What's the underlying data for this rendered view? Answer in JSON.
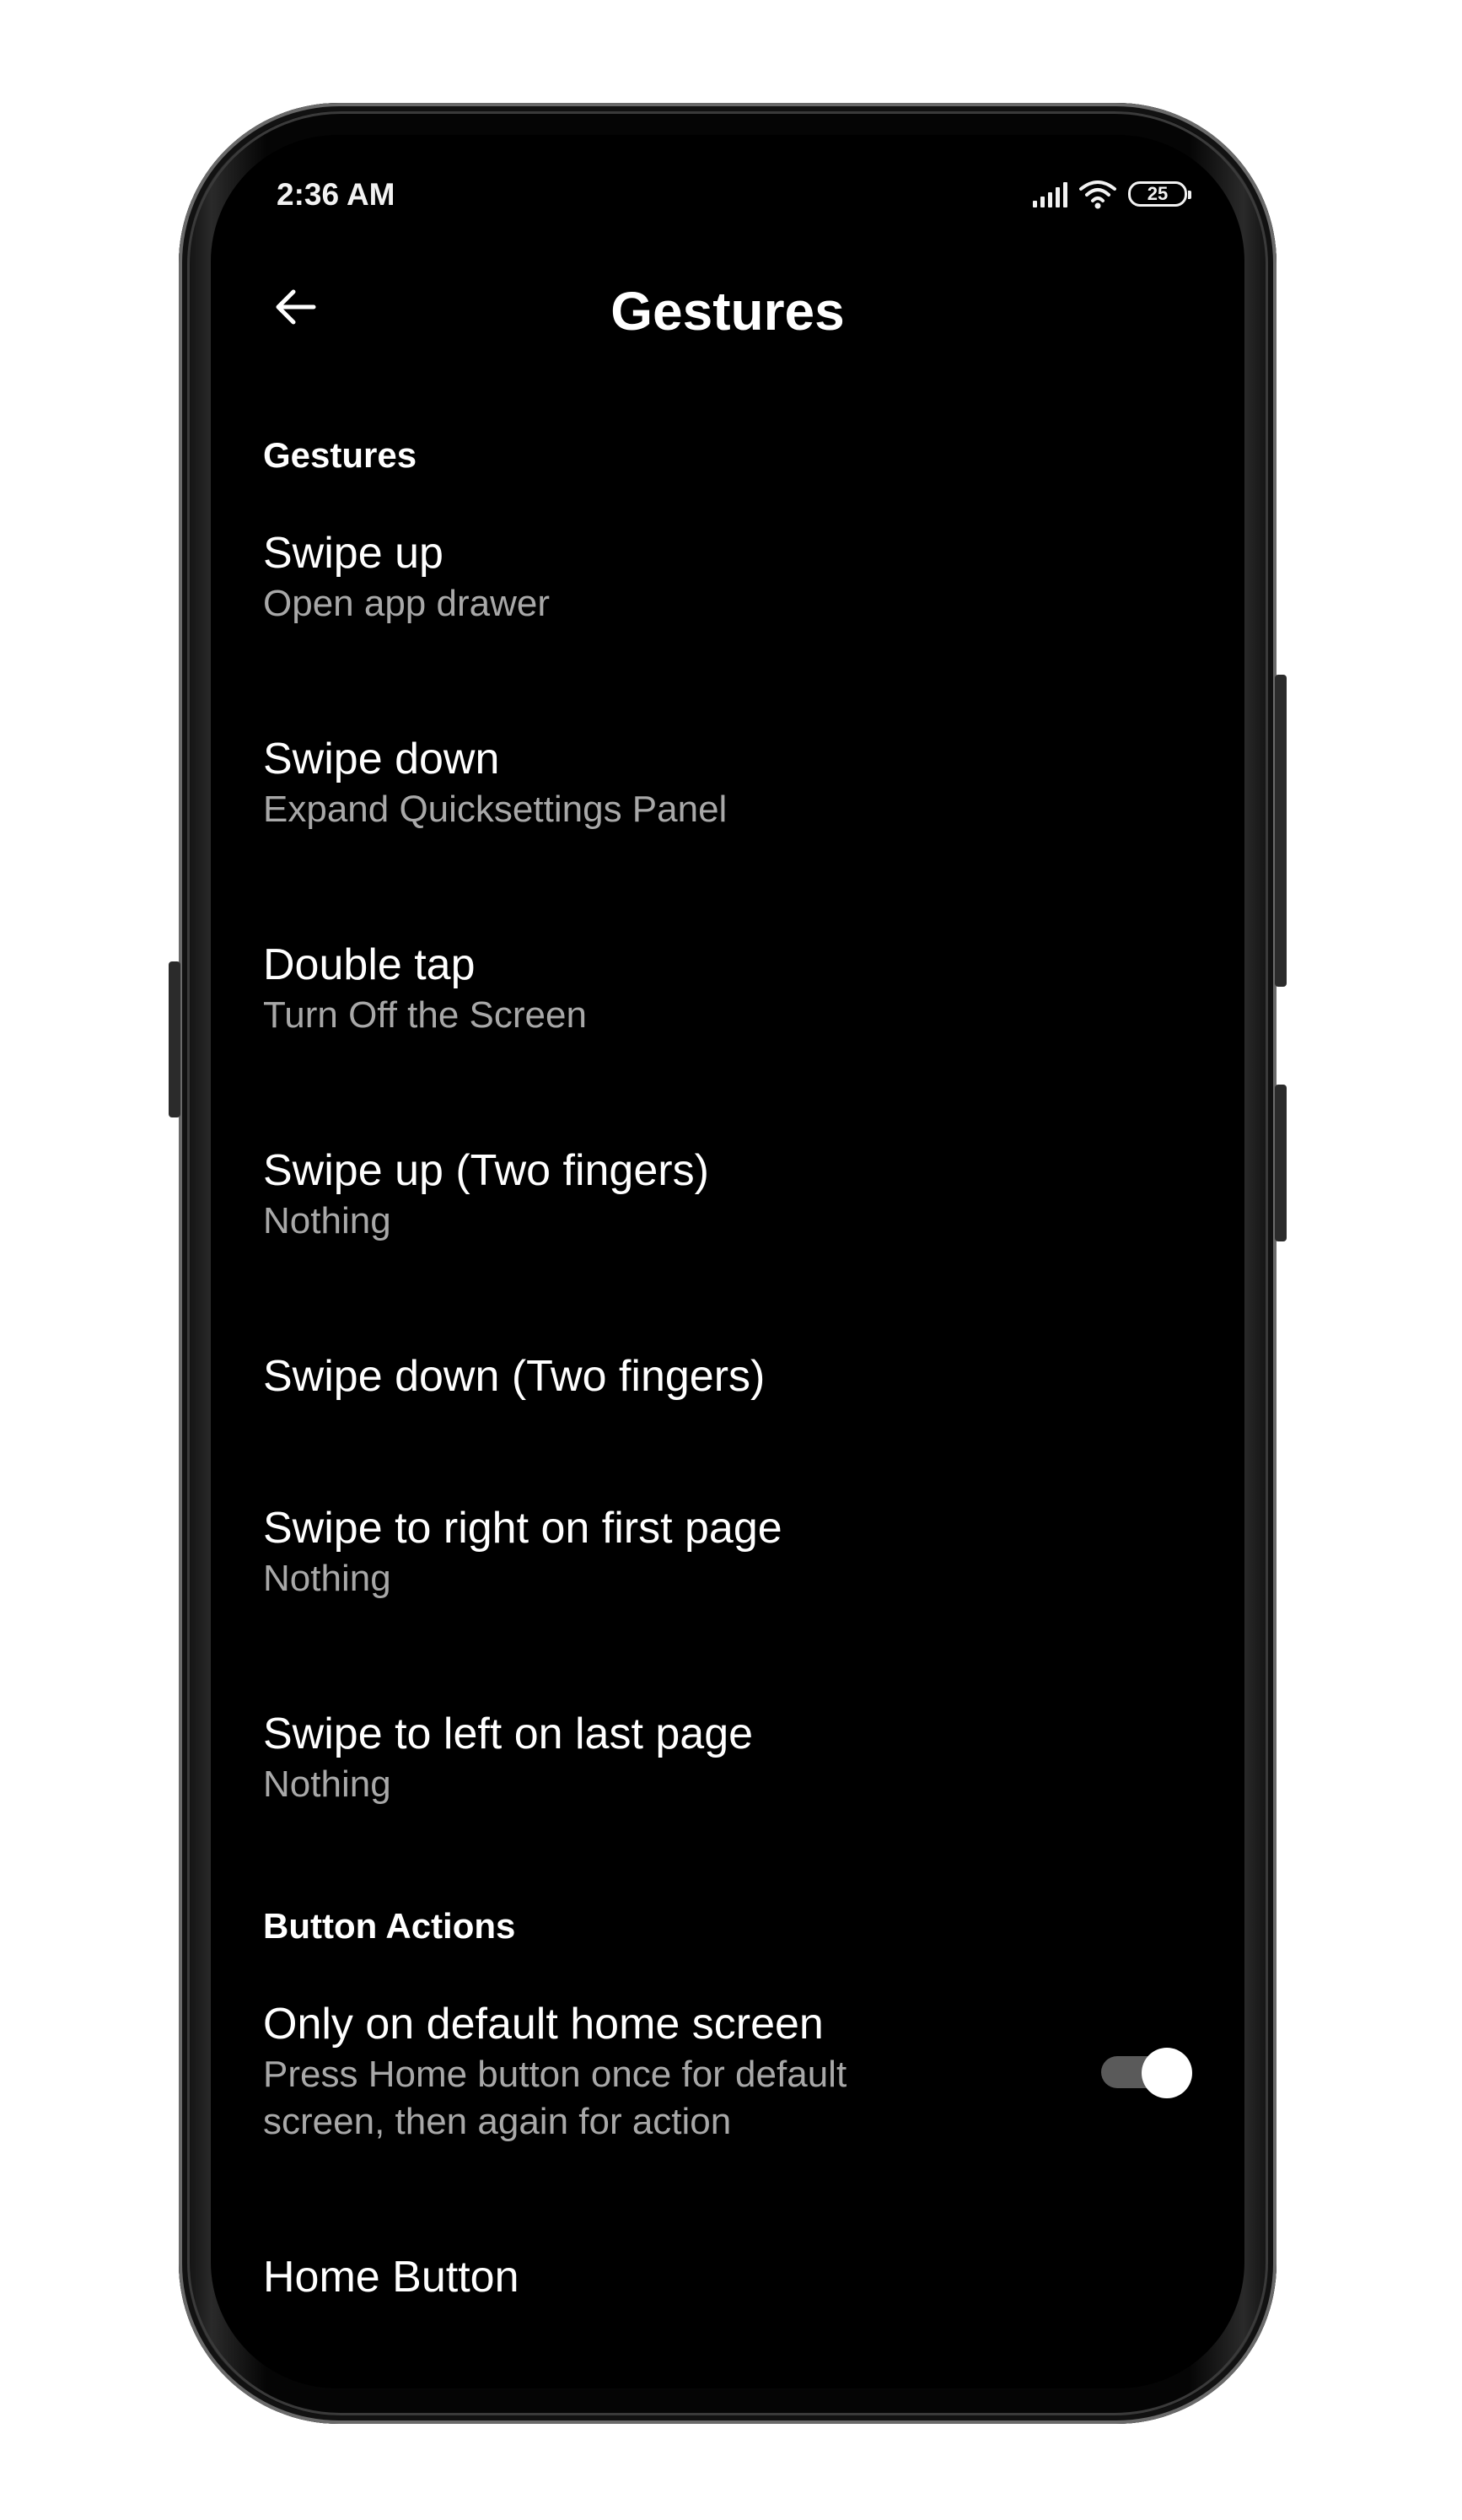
{
  "status_bar": {
    "time": "2:36 AM",
    "battery": "25",
    "icons": [
      "signal-icon",
      "wifi-icon",
      "battery-icon"
    ]
  },
  "header": {
    "title": "Gestures",
    "back_icon": "arrow-left-icon"
  },
  "sections": {
    "gestures": {
      "header": "Gestures",
      "items": [
        {
          "title": "Swipe up",
          "subtitle": "Open app drawer"
        },
        {
          "title": "Swipe down",
          "subtitle": "Expand Quicksettings Panel"
        },
        {
          "title": "Double tap",
          "subtitle": "Turn Off the Screen"
        },
        {
          "title": "Swipe up (Two fingers)",
          "subtitle": "Nothing"
        },
        {
          "title": "Swipe down (Two fingers)"
        },
        {
          "title": "Swipe to right on first page",
          "subtitle": "Nothing"
        },
        {
          "title": "Swipe to left on last page",
          "subtitle": "Nothing"
        }
      ]
    },
    "button_actions": {
      "header": "Button Actions",
      "items": [
        {
          "title": "Only on default home screen",
          "subtitle_line1": "Press Home button once for default",
          "subtitle_line2": "screen, then again for action",
          "toggle_on": true
        },
        {
          "title": "Home Button"
        }
      ]
    }
  }
}
